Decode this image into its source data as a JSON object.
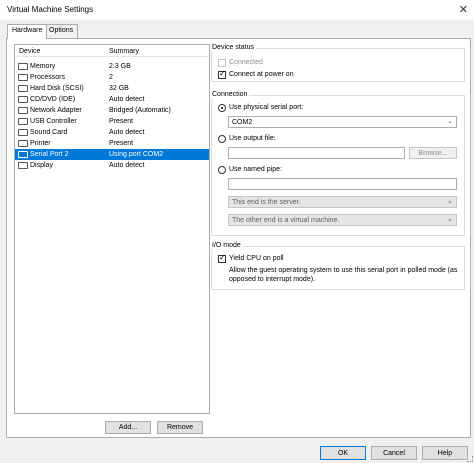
{
  "window": {
    "title": "Virtual Machine Settings"
  },
  "tabs": [
    {
      "label": "Hardware"
    },
    {
      "label": "Options"
    }
  ],
  "device_list": {
    "headers": {
      "device": "Device",
      "summary": "Summary"
    },
    "rows": [
      {
        "name": "Memory",
        "summary": "2.3 GB",
        "icon": "memory-icon"
      },
      {
        "name": "Processors",
        "summary": "2",
        "icon": "processor-icon"
      },
      {
        "name": "Hard Disk (SCSI)",
        "summary": "32 GB",
        "icon": "hard-disk-icon"
      },
      {
        "name": "CD/DVD (IDE)",
        "summary": "Auto detect",
        "icon": "cd-dvd-icon"
      },
      {
        "name": "Network Adapter",
        "summary": "Bridged (Automatic)",
        "icon": "network-adapter-icon"
      },
      {
        "name": "USB Controller",
        "summary": "Present",
        "icon": "usb-icon"
      },
      {
        "name": "Sound Card",
        "summary": "Auto detect",
        "icon": "sound-card-icon"
      },
      {
        "name": "Printer",
        "summary": "Present",
        "icon": "printer-icon"
      },
      {
        "name": "Serial Port 2",
        "summary": "Using port COM2",
        "icon": "serial-port-icon"
      },
      {
        "name": "Display",
        "summary": "Auto detect",
        "icon": "display-icon"
      }
    ]
  },
  "list_buttons": {
    "add": "Add...",
    "remove": "Remove"
  },
  "device_status": {
    "title": "Device status",
    "connected": "Connected",
    "connect_at_power_on": "Connect at power on"
  },
  "connection": {
    "title": "Connection",
    "use_physical": "Use physical serial port:",
    "physical_value": "COM2",
    "use_output_file": "Use output file:",
    "browse": "Browse...",
    "use_named_pipe": "Use named pipe:",
    "pipe_end": "This end is the server.",
    "pipe_other": "The other end is a virtual machine."
  },
  "io_mode": {
    "title": "I/O mode",
    "yield_cpu": "Yield CPU on poll",
    "description_line1": "Allow the guest operating system to use this serial port in polled mode (as",
    "description_line2": "opposed to interrupt mode)."
  },
  "footer": {
    "ok": "OK",
    "cancel": "Cancel",
    "help": "Help"
  },
  "colors": {
    "selection": "#0078d7",
    "window_bg": "#f0f0f0"
  }
}
